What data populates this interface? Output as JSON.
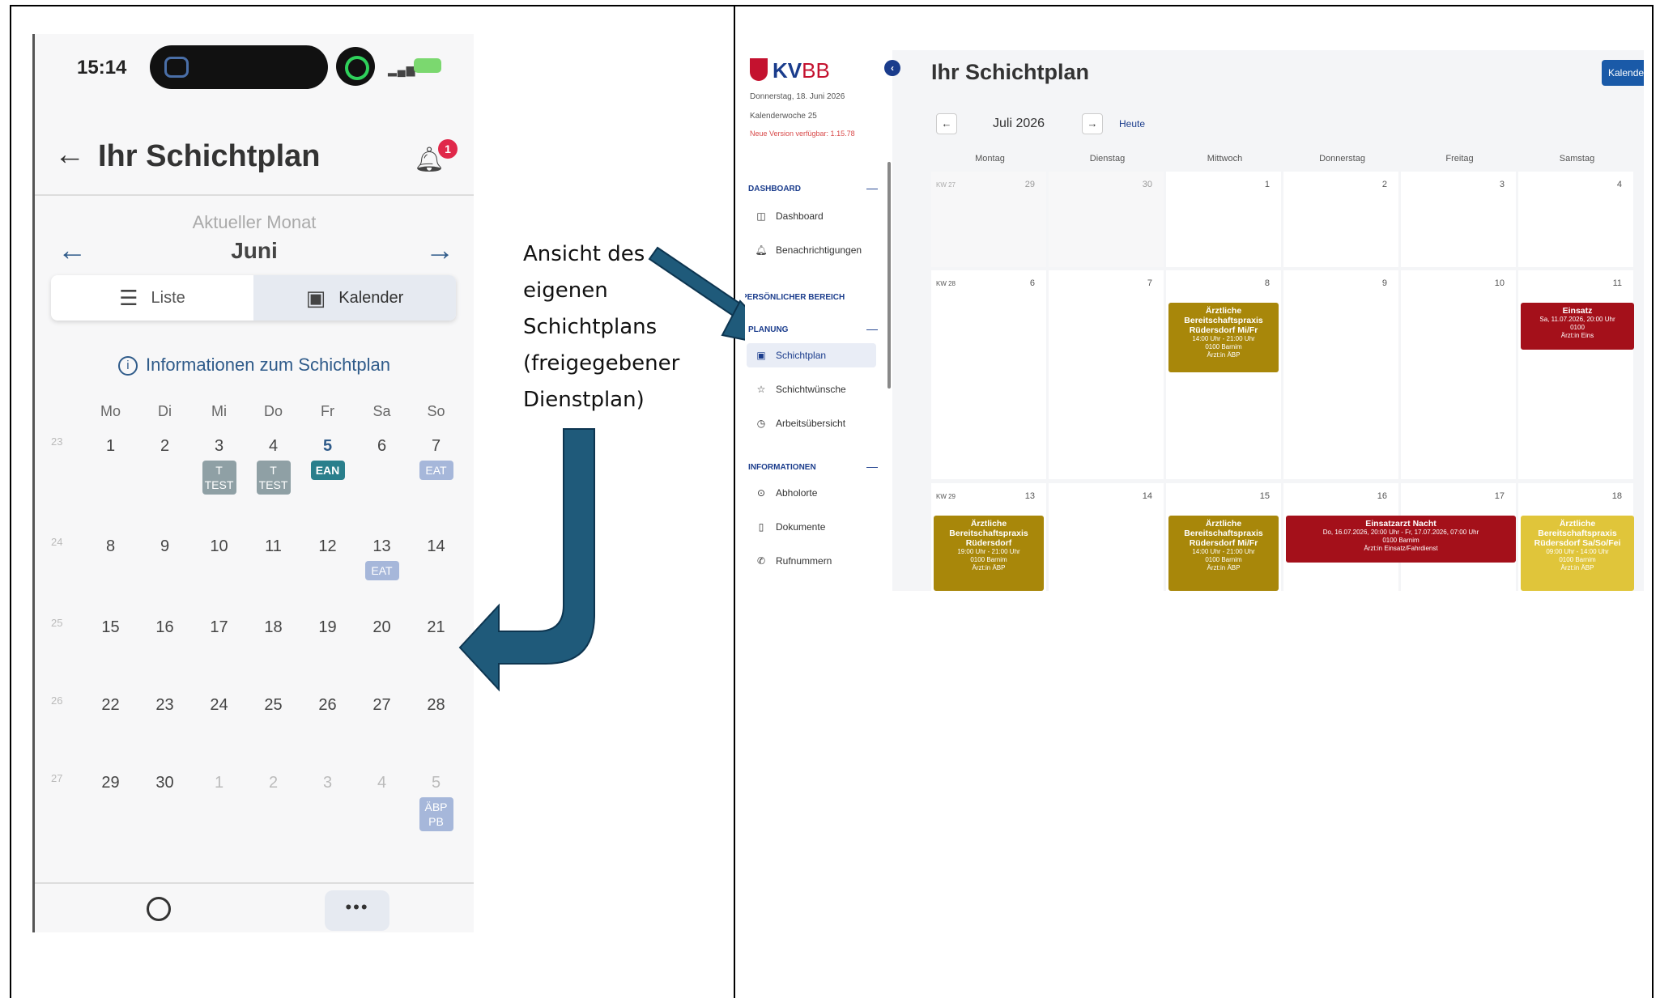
{
  "phone": {
    "status_time": "15:14",
    "title": "Ihr Schichtplan",
    "notification_count": "1",
    "month_subtitle": "Aktueller Monat",
    "month_name": "Juni",
    "toggle": {
      "list_label": "Liste",
      "calendar_label": "Kalender"
    },
    "info_link": "Informationen zum Schichtplan",
    "weekdays": [
      "Mo",
      "Di",
      "Mi",
      "Do",
      "Fr",
      "Sa",
      "So"
    ],
    "weeks": [
      {
        "kw": "23",
        "days": [
          {
            "n": "1"
          },
          {
            "n": "2"
          },
          {
            "n": "3",
            "chip": "T TEST",
            "chip_color": "gray"
          },
          {
            "n": "4",
            "chip": "T TEST",
            "chip_color": "gray"
          },
          {
            "n": "5",
            "chip": "EAN",
            "chip_color": "teal",
            "today": true
          },
          {
            "n": "6"
          },
          {
            "n": "7",
            "chip": "EAT",
            "chip_color": "light"
          }
        ]
      },
      {
        "kw": "24",
        "days": [
          {
            "n": "8"
          },
          {
            "n": "9"
          },
          {
            "n": "10"
          },
          {
            "n": "11"
          },
          {
            "n": "12"
          },
          {
            "n": "13",
            "chip": "EAT",
            "chip_color": "light"
          },
          {
            "n": "14"
          }
        ]
      },
      {
        "kw": "25",
        "days": [
          {
            "n": "15"
          },
          {
            "n": "16"
          },
          {
            "n": "17"
          },
          {
            "n": "18"
          },
          {
            "n": "19"
          },
          {
            "n": "20"
          },
          {
            "n": "21"
          }
        ]
      },
      {
        "kw": "26",
        "days": [
          {
            "n": "22"
          },
          {
            "n": "23"
          },
          {
            "n": "24"
          },
          {
            "n": "25"
          },
          {
            "n": "26"
          },
          {
            "n": "27"
          },
          {
            "n": "28"
          }
        ]
      },
      {
        "kw": "27",
        "days": [
          {
            "n": "29"
          },
          {
            "n": "30"
          },
          {
            "n": "1",
            "muted": true
          },
          {
            "n": "2",
            "muted": true
          },
          {
            "n": "3",
            "muted": true
          },
          {
            "n": "4",
            "muted": true
          },
          {
            "n": "5",
            "muted": true,
            "chip": "ÄBP PB",
            "chip_color": "light"
          }
        ]
      }
    ],
    "bottom_more": "•••"
  },
  "annotation": {
    "lines": [
      "Ansicht des",
      "eigenen",
      "Schichtplans",
      "(freigegebener",
      "Dienstplan)"
    ],
    "arrow_color": "#1f5a7a"
  },
  "web": {
    "logo": {
      "kv": "KV",
      "bb": "BB"
    },
    "date_line": "Donnerstag, 18. Juni 2026",
    "kw_line": "Kalenderwoche 25",
    "version_line": "Neue Version verfügbar: 1.15.78",
    "sections": {
      "dashboard": "DASHBOARD",
      "personal": "PERSÖNLICHER BEREICH",
      "planning": "PLANUNG",
      "information": "INFORMATIONEN"
    },
    "menu": {
      "dashboard": "Dashboard",
      "notifications": "Benachrichtigungen",
      "schichtplan": "Schichtplan",
      "schichtwuensche": "Schichtwünsche",
      "arbeitsuebersicht": "Arbeitsübersicht",
      "abholorte": "Abholorte",
      "dokumente": "Dokumente",
      "rufnummern": "Rufnummern"
    },
    "title": "Ihr Schichtplan",
    "kalender_button": "Kalender",
    "month": "Juli 2026",
    "today_link": "Heute",
    "weekdays": [
      "Montag",
      "Dienstag",
      "Mittwoch",
      "Donnerstag",
      "Freitag",
      "Samstag"
    ],
    "weeks": [
      {
        "kw": "KW 27",
        "days": [
          "29",
          "30",
          "1",
          "2",
          "3",
          "4"
        ]
      },
      {
        "kw": "KW 28",
        "days": [
          "6",
          "7",
          "8",
          "9",
          "10",
          "11"
        ]
      },
      {
        "kw": "KW 29",
        "days": [
          "13",
          "14",
          "15",
          "16",
          "17",
          "18"
        ]
      }
    ],
    "events": {
      "w28_wed": {
        "title": "Ärztliche Bereitschaftspraxis Rüdersdorf Mi/Fr",
        "time": "14:00 Uhr - 21:00 Uhr",
        "location": "0100 Barnim",
        "role": "Ärzt:in ÄBP"
      },
      "w28_sat": {
        "title": "Einsatz",
        "time": "Sa, 11.07.2026, 20:00 Uhr",
        "location": "0100",
        "role": "Ärzt:in Eins"
      },
      "w29_mon": {
        "title": "Ärztliche Bereitschaftspraxis Rüdersdorf",
        "time": "19:00 Uhr - 21:00 Uhr",
        "location": "0100 Barnim",
        "role": "Ärzt:in ÄBP"
      },
      "w29_wed": {
        "title": "Ärztliche Bereitschaftspraxis Rüdersdorf Mi/Fr",
        "time": "14:00 Uhr - 21:00 Uhr",
        "location": "0100 Barnim",
        "role": "Ärzt:in ÄBP"
      },
      "w29_thu": {
        "title": "Einsatzarzt Nacht",
        "time": "Do, 16.07.2026, 20:00 Uhr - Fr, 17.07.2026, 07:00 Uhr",
        "location": "0100 Barnim",
        "role": "Ärzt:in Einsatz/Fahrdienst"
      },
      "w29_sat": {
        "title": "Ärztliche Bereitschaftspraxis Rüdersdorf Sa/So/Fei",
        "time": "09:00 Uhr - 14:00 Uhr",
        "location": "0100 Barnim",
        "role": "Ärzt:in ÄBP"
      }
    },
    "colors": {
      "olive": "#a8870a",
      "red": "#a4101a",
      "yellow": "#e0c53a",
      "brand_blue": "#1a3c8c"
    }
  }
}
